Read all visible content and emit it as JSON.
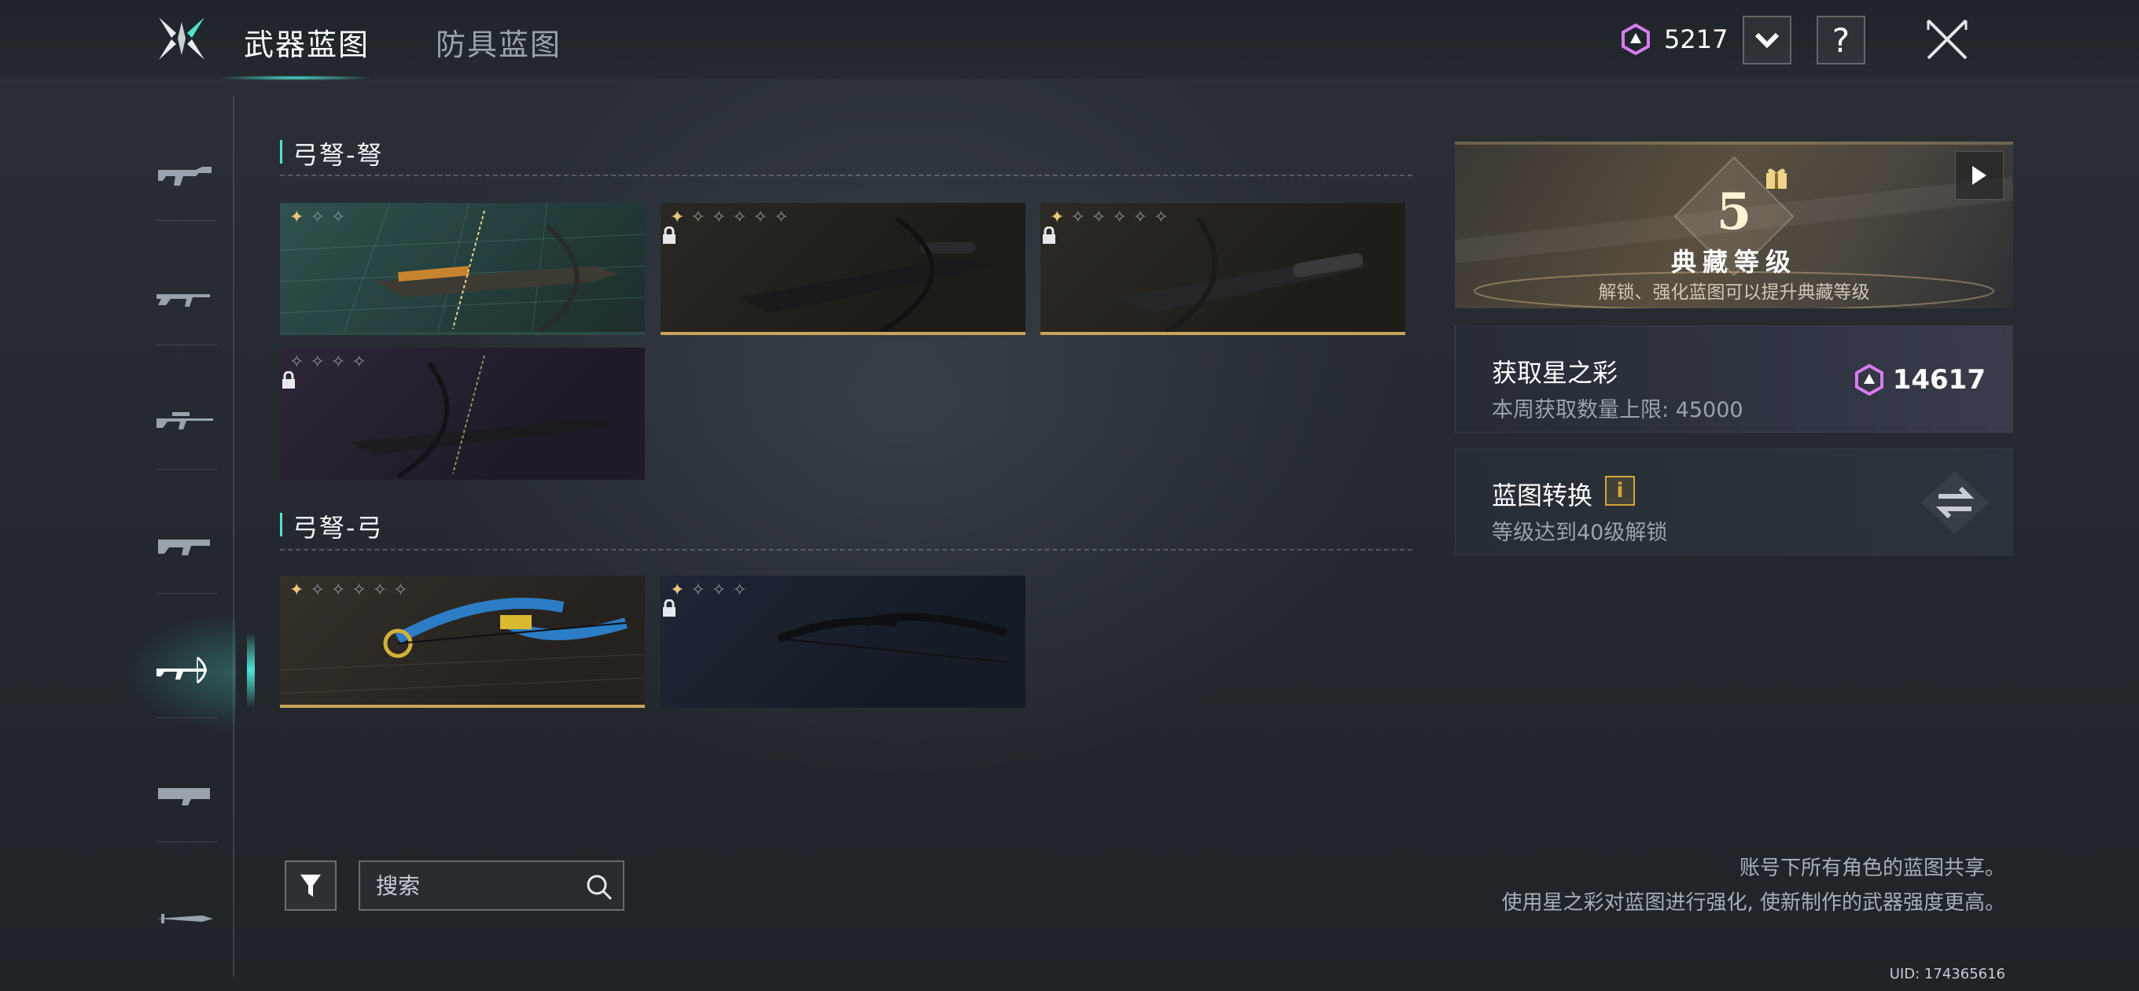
{
  "header": {
    "tabs": [
      {
        "label": "武器蓝图",
        "active": true
      },
      {
        "label": "防具蓝图",
        "active": false
      }
    ],
    "currency_value": "5217",
    "help_label": "?",
    "icons": {
      "logo": "game-logo",
      "currency": "star-gem-icon",
      "dropdown": "chevron-down-icon",
      "help": "question-icon",
      "close": "close-icon"
    }
  },
  "sidebar": {
    "items": [
      {
        "name": "smg",
        "active": false
      },
      {
        "name": "rifle",
        "active": false
      },
      {
        "name": "sniper",
        "active": false
      },
      {
        "name": "shotgun",
        "active": false
      },
      {
        "name": "crossbow",
        "active": true
      },
      {
        "name": "heavy",
        "active": false
      },
      {
        "name": "melee",
        "active": false
      }
    ]
  },
  "sections": [
    {
      "title": "弓弩-弩",
      "cards": [
        {
          "stars_lit": 1,
          "stars_total": 3,
          "locked": false,
          "tint": "#2c4a46",
          "bar": "#c9a35a"
        },
        {
          "stars_lit": 1,
          "stars_total": 6,
          "locked": true,
          "tint": "#2a2620",
          "bar": "#c9a35a"
        },
        {
          "stars_lit": 1,
          "stars_total": 6,
          "locked": true,
          "tint": "#2a2620",
          "bar": "#c9a35a"
        },
        {
          "stars_lit": 0,
          "stars_total": 4,
          "locked": true,
          "tint": "#2b2234",
          "bar": "#2b2234"
        }
      ]
    },
    {
      "title": "弓弩-弓",
      "cards": [
        {
          "stars_lit": 1,
          "stars_total": 6,
          "locked": false,
          "tint": "#2e2a24",
          "bar": "#c9a35a"
        },
        {
          "stars_lit": 1,
          "stars_total": 4,
          "locked": true,
          "tint": "#1c2330",
          "bar": "#1c2330"
        }
      ]
    }
  ],
  "collection": {
    "level": "5",
    "title": "典藏等级",
    "subtitle": "解锁、强化蓝图可以提升典藏等级"
  },
  "star_color_panel": {
    "title": "获取星之彩",
    "subtitle": "本周获取数量上限: 45000",
    "count": "14617"
  },
  "convert_panel": {
    "title": "蓝图转换",
    "info_badge": "i",
    "subtitle": "等级达到40级解锁"
  },
  "notes": {
    "line1": "账号下所有角色的蓝图共享。",
    "line2": "使用星之彩对蓝图进行强化, 使新制作的武器强度更高。"
  },
  "uid": "UID: 174365616",
  "search": {
    "placeholder": "搜索"
  },
  "colors": {
    "accent": "#4fe3d3",
    "gold": "#c9a35a",
    "gem": "#d77cf0"
  }
}
